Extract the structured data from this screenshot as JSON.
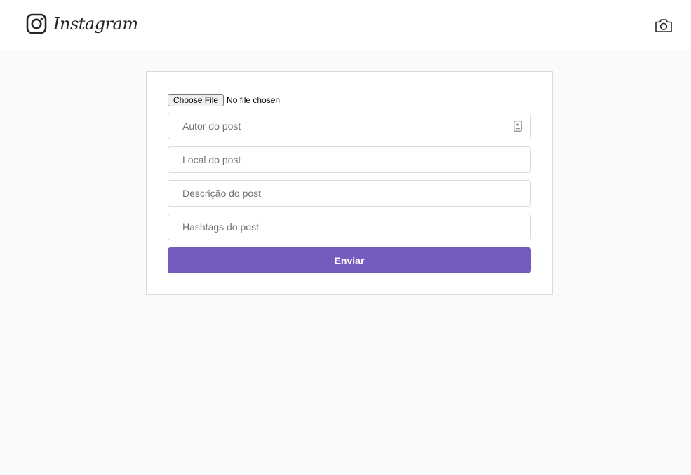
{
  "header": {
    "brand": "Instagram",
    "logo_icon": "instagram-glyph-icon",
    "camera_icon": "camera-icon"
  },
  "form": {
    "file_button_label": "Choose File",
    "file_status": "No file chosen",
    "author_placeholder": "Autor do post",
    "location_placeholder": "Local do post",
    "description_placeholder": "Descrição do post",
    "hashtags_placeholder": "Hashtags do post",
    "submit_label": "Enviar"
  },
  "colors": {
    "accent": "#745bbd",
    "background": "#fafafa",
    "border": "#dbdbdb"
  }
}
